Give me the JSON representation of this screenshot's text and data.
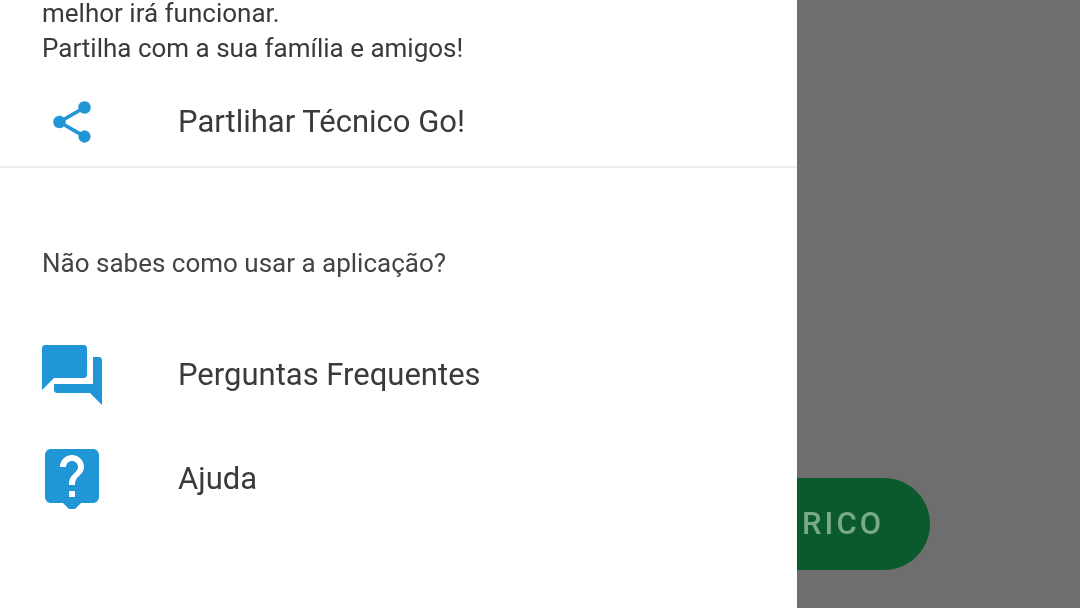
{
  "drawer": {
    "intro_lines": [
      "melhor irá funcionar.",
      "Partilha com a sua família e amigos!"
    ],
    "share_item": {
      "label": "Partlihar Técnico Go!"
    },
    "help_heading": "Não sabes como usar a aplicação?",
    "help_items": [
      {
        "label": "Perguntas Frequentes"
      },
      {
        "label": "Ajuda"
      }
    ]
  },
  "background": {
    "button_label": "RICO"
  }
}
